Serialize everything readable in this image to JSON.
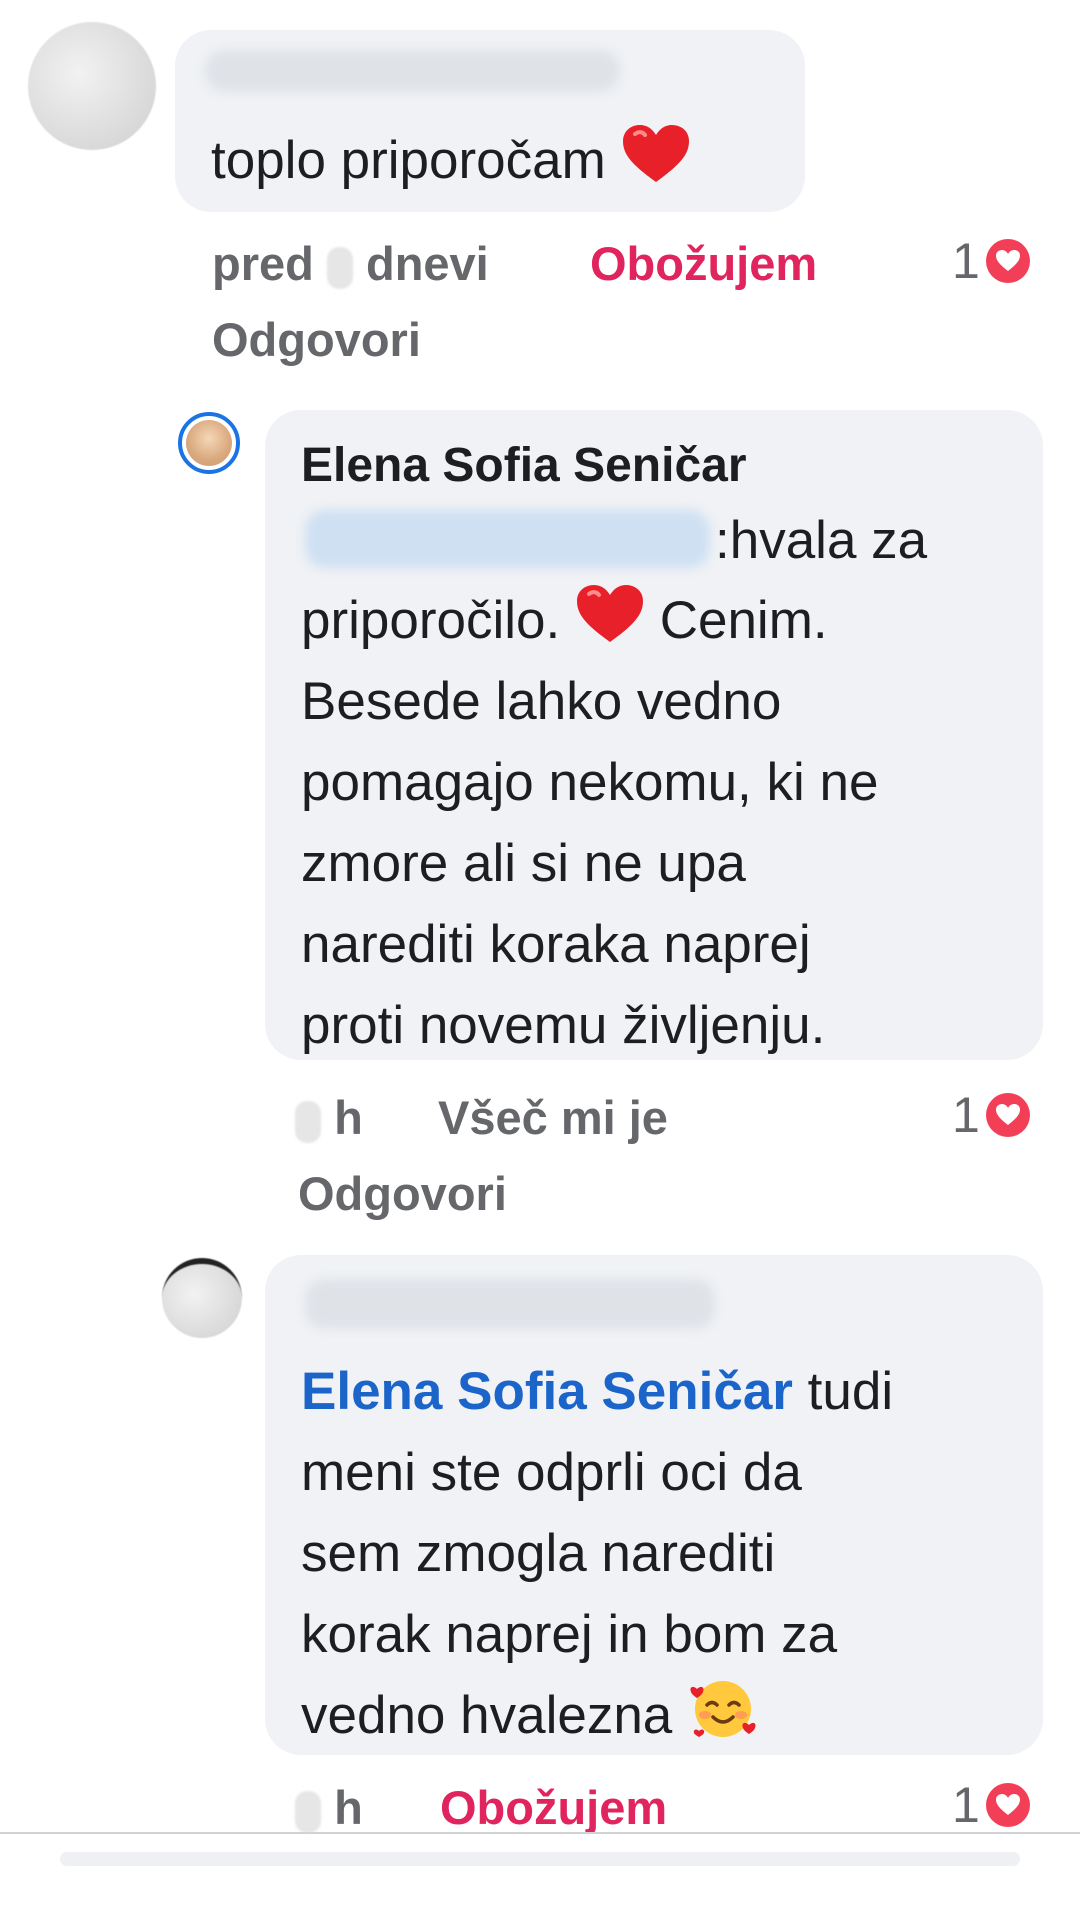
{
  "comments": [
    {
      "text": "toplo priporočam",
      "time_prefix": "pred",
      "time_suffix": "dnevi",
      "reaction": "Obožujem",
      "reply": "Odgovori",
      "reaction_count": "1"
    },
    {
      "author": "Elena Sofia Seničar",
      "partial": ":hvala za",
      "lines": [
        "priporočilo.",
        "Cenim.",
        "Besede lahko vedno",
        "pomagajo nekomu, ki ne",
        "zmore ali si ne upa",
        "narediti koraka naprej",
        "proti novemu življenju."
      ],
      "time_unit": "h",
      "reaction": "Všeč mi je",
      "reply": "Odgovori",
      "reaction_count": "1"
    },
    {
      "mention": "Elena Sofia Seničar",
      "after_mention": "tudi",
      "lines": [
        "meni ste odprli oci da",
        "sem zmogla narediti",
        "korak naprej in bom za",
        "vedno hvalezna"
      ],
      "time_unit": "h",
      "reaction": "Obožujem",
      "reaction_count": "1"
    }
  ],
  "colors": {
    "love": "#e0245e",
    "mention": "#1b64c9",
    "bubble": "#f0f2f5",
    "meta": "#65676b"
  },
  "icons": [
    "heart-emoji",
    "smiling-face-with-hearts-emoji",
    "love-reaction-icon"
  ]
}
